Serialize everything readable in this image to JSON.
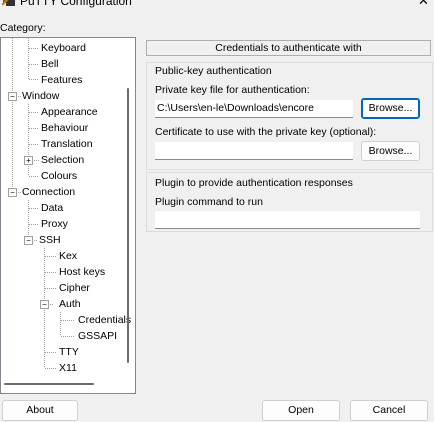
{
  "window": {
    "title": "PuTTY Configuration",
    "close_symbol": "✕"
  },
  "category_label": "Category:",
  "tree": {
    "keyboard": "Keyboard",
    "bell": "Bell",
    "features": "Features",
    "window": "Window",
    "appearance": "Appearance",
    "behaviour": "Behaviour",
    "translation": "Translation",
    "selection": "Selection",
    "colours": "Colours",
    "connection": "Connection",
    "data": "Data",
    "proxy": "Proxy",
    "ssh": "SSH",
    "kex": "Kex",
    "host_keys": "Host keys",
    "cipher": "Cipher",
    "auth": "Auth",
    "credentials": "Credentials",
    "gssapi": "GSSAPI",
    "tty": "TTY",
    "x11": "X11",
    "collapse_symbol": "−",
    "expand_symbol": "+"
  },
  "panel": {
    "header": "Credentials to authenticate with",
    "pubkey_group_label": "Public-key authentication",
    "private_key_label": "Private key file for authentication:",
    "private_key_value": "C:\\Users\\en-le\\Downloads\\encore",
    "browse_label": "Browse...",
    "cert_label": "Certificate to use with the private key (optional):",
    "cert_value": "",
    "plugin_group_label": "Plugin to provide authentication responses",
    "plugin_command_label": "Plugin command to run",
    "plugin_command_value": ""
  },
  "buttons": {
    "about": "About",
    "open": "Open",
    "cancel": "Cancel"
  },
  "colors": {
    "focus_border": "#0067c0",
    "background": "#f0f0f0"
  }
}
